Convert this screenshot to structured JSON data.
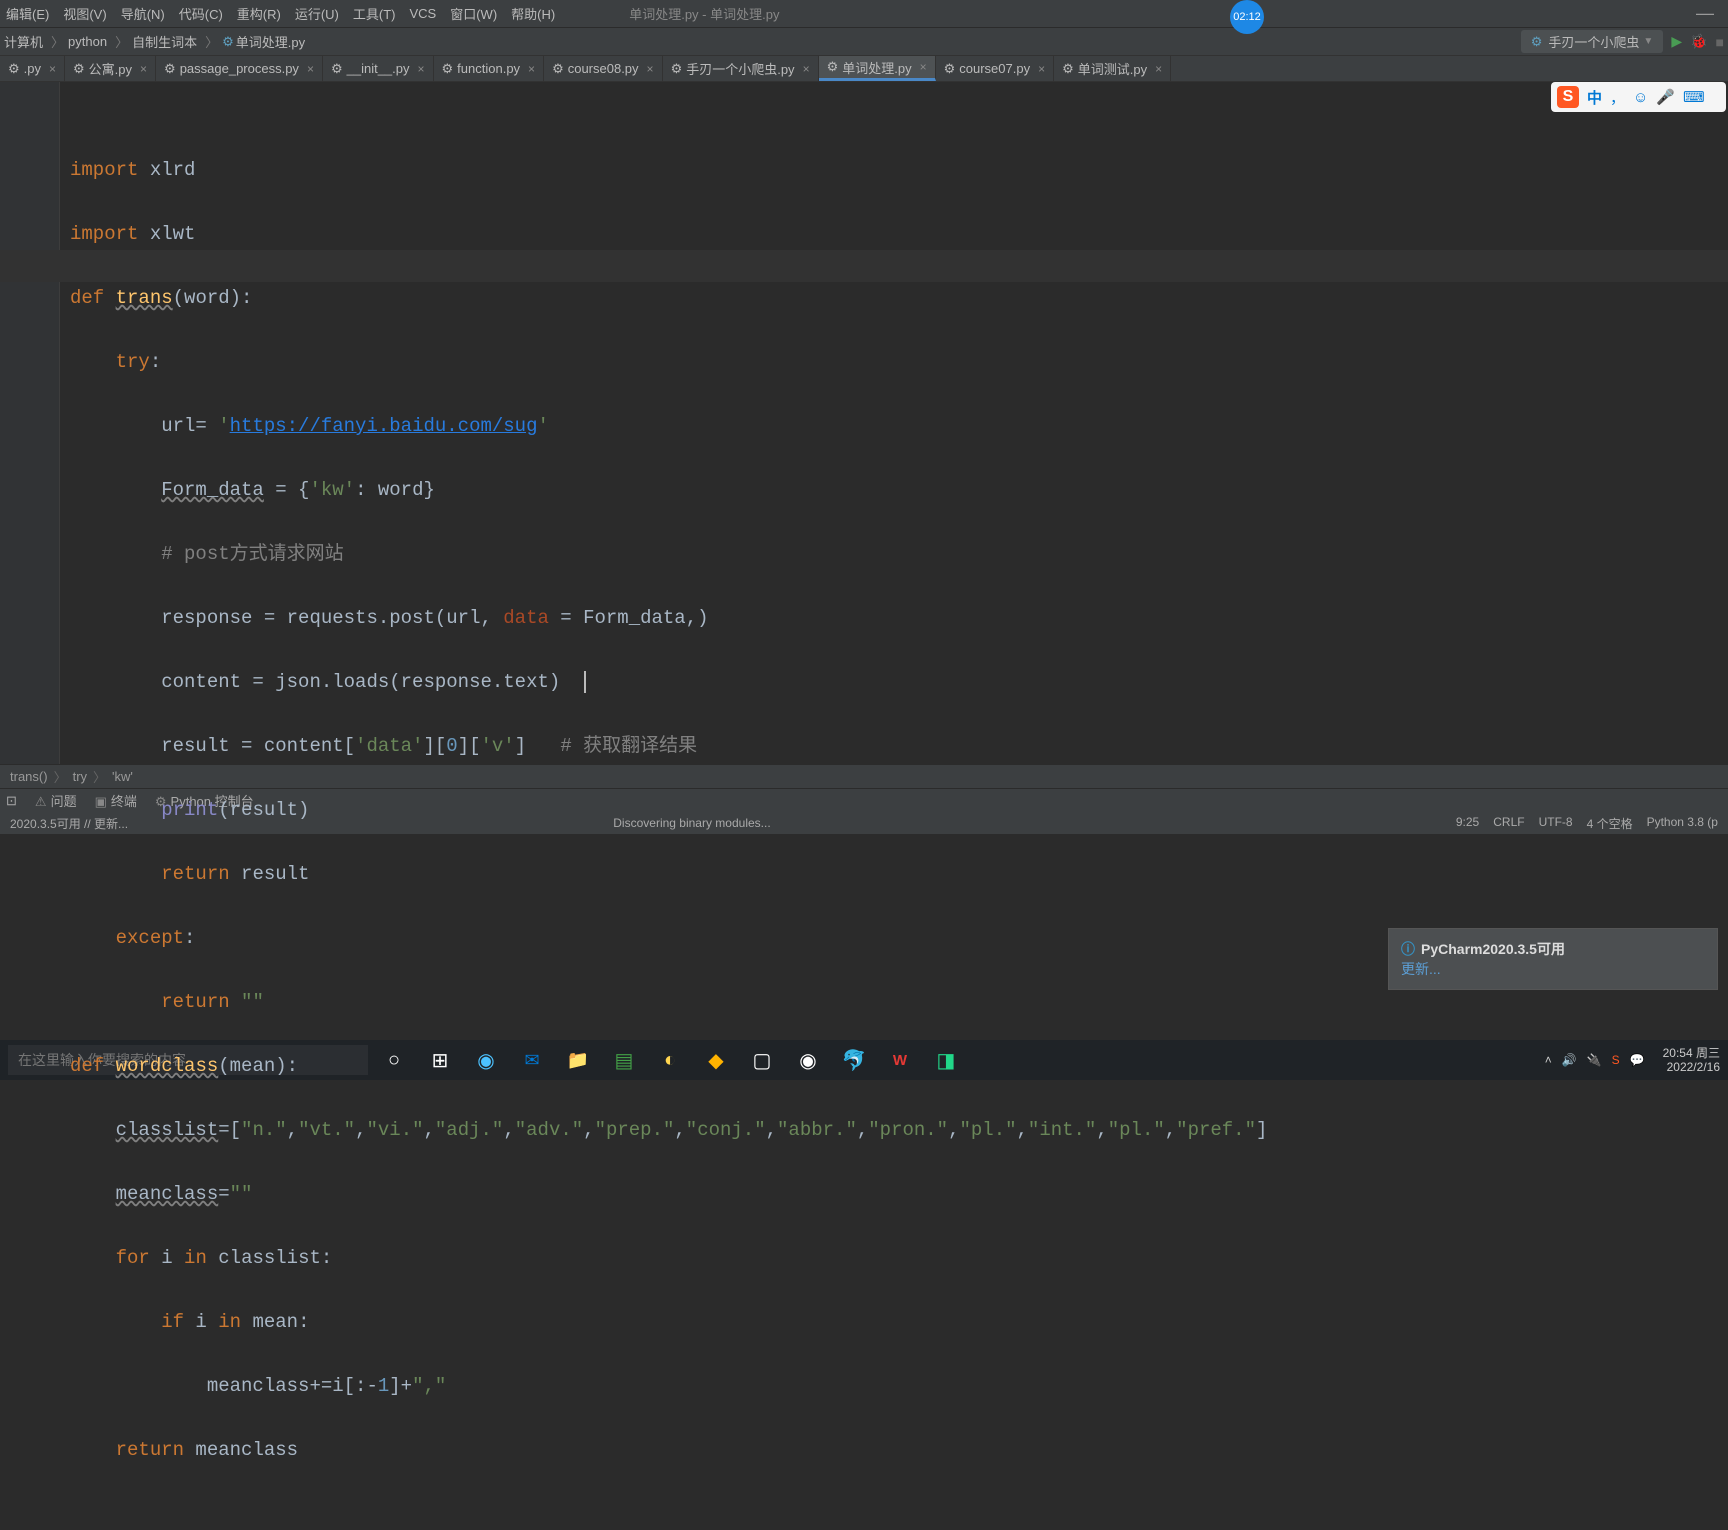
{
  "menubar": {
    "items": [
      "编辑(E)",
      "视图(V)",
      "导航(N)",
      "代码(C)",
      "重构(R)",
      "运行(U)",
      "工具(T)",
      "VCS",
      "窗口(W)",
      "帮助(H)"
    ],
    "title": "单词处理.py - 单词处理.py",
    "timer": "02:12"
  },
  "breadcrumbs": {
    "items": [
      "计算机",
      "python",
      "自制生词本",
      "单词处理.py"
    ],
    "runconfig": "手刃一个小爬虫"
  },
  "tabs": [
    {
      "label": ".py",
      "active": false
    },
    {
      "label": "公寓.py",
      "active": false
    },
    {
      "label": "passage_process.py",
      "active": false
    },
    {
      "label": "__init__.py",
      "active": false
    },
    {
      "label": "function.py",
      "active": false
    },
    {
      "label": "course08.py",
      "active": false
    },
    {
      "label": "手刃一个小爬虫.py",
      "active": false
    },
    {
      "label": "单词处理.py",
      "active": true
    },
    {
      "label": "course07.py",
      "active": false
    },
    {
      "label": "单词测试.py",
      "active": false
    }
  ],
  "code": {
    "lines": [
      "import xlrd",
      "import xlwt",
      "def trans(word):",
      "    try:",
      "        url= 'https://fanyi.baidu.com/sug'",
      "        Form_data = {'kw': word}",
      "        # post方式请求网站",
      "        response = requests.post(url, data = Form_data,)",
      "        content = json.loads(response.text)",
      "        result = content['data'][0]['v']   # 获取翻译结果",
      "        print(result)",
      "        return result",
      "    except:",
      "        return \"\"",
      "def wordclass(mean):",
      "    classlist=[\"n.\",\"vt.\",\"vi.\",\"adj.\",\"adv.\",\"prep.\",\"conj.\",\"abbr.\",\"pron.\",\"pl.\",\"int.\",\"pl.\",\"pref.\"]",
      "    meanclass=\"\"",
      "    for i in classlist:",
      "        if i in mean:",
      "            meanclass+=i[:-1]+\",\"",
      "    return meanclass"
    ]
  },
  "editor_breadcrumb": [
    "trans()",
    "try",
    "'kw'"
  ],
  "bottomtools": [
    "问题",
    "终端",
    "Python 控制台"
  ],
  "statusbar": {
    "left": "2020.3.5可用 // 更新...",
    "discovering": "Discovering binary modules...",
    "pos": "9:25",
    "linesep": "CRLF",
    "encoding": "UTF-8",
    "indent": "4 个空格",
    "python": "Python 3.8 (p"
  },
  "notification": {
    "title": "PyCharm2020.3.5可用",
    "link": "更新..."
  },
  "taskbar": {
    "search_placeholder": "在这里输入你要搜索的内容",
    "clock_time": "20:54 周三",
    "clock_date": "2022/2/16"
  },
  "ime": {
    "zhong": "中",
    "comma": "，"
  }
}
